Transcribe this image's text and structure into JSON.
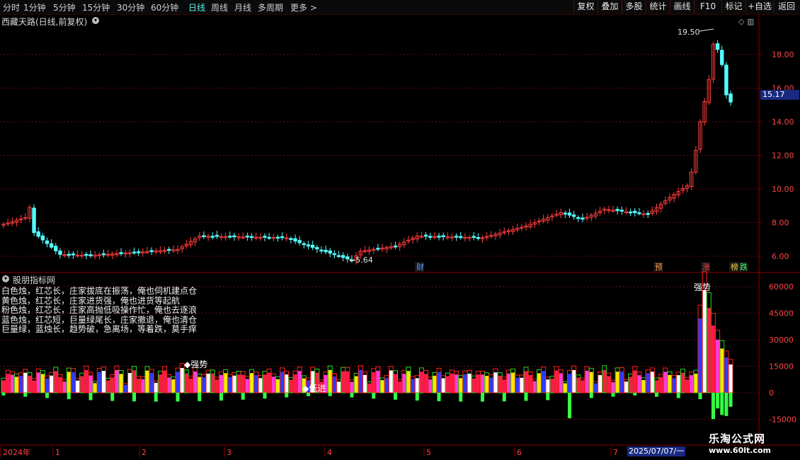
{
  "toolbar": {
    "periods": [
      "分时",
      "1分钟",
      "5分钟",
      "15分钟",
      "30分钟",
      "60分钟",
      "日线",
      "周线",
      "月线",
      "多周期",
      "更多 >"
    ],
    "active_period": "日线",
    "actions": [
      "复权",
      "叠加",
      "多股",
      "统计",
      "画线",
      "F10",
      "标记",
      "+自选",
      "返回"
    ]
  },
  "chart": {
    "title": "西藏天路(日线,前复权)",
    "high_label": "19.50",
    "low_label": "5.64",
    "current_price": "15.17",
    "price_axis": [
      "18.00",
      "16.00",
      "14.00",
      "12.00",
      "10.00",
      "8.00",
      "6.00"
    ],
    "event_tags": [
      {
        "text": "财",
        "color": "#5aa0ff"
      },
      {
        "text": "预",
        "color": "#ff9a3c"
      },
      {
        "text": "涨",
        "color": "#ff4a4a"
      },
      {
        "text": "榜",
        "color": "#ffd24a"
      },
      {
        "text": "跌",
        "color": "#4aff6a"
      }
    ]
  },
  "indicator": {
    "name": "股朋指标网",
    "legend": [
      "白色烛，红芯长，庄家拔底在振荡，俺也伺机建点仓",
      "黄色烛，红芯长，庄家进货强，俺也进货等起航",
      "粉色烛，红芯长，庄家高抛低吸操作忙，俺也去逐浪",
      "蓝色烛，红芯短，巨量绿尾长，庄家撤退，俺也清仓",
      "巨量绿，蓝烛长，趋势破，急离场，等着跌，莫手痒"
    ],
    "annotations": [
      "强势",
      "强势",
      "低进"
    ],
    "axis": [
      "60000",
      "45000",
      "30000",
      "15000",
      "0",
      "-15000"
    ]
  },
  "time_axis": {
    "labels": [
      "2024年",
      "1",
      "2",
      "3",
      "4",
      "5",
      "6",
      "7"
    ],
    "current_date": "2025/07/07/一"
  },
  "watermark": {
    "name": "乐淘公式网",
    "url": "www.60lt.com"
  },
  "colors": {
    "up": "#ff3c3c",
    "down": "#54ffff",
    "grid": "#6a0a0a",
    "axis_text": "#ff4444",
    "bg": "#000000"
  }
}
